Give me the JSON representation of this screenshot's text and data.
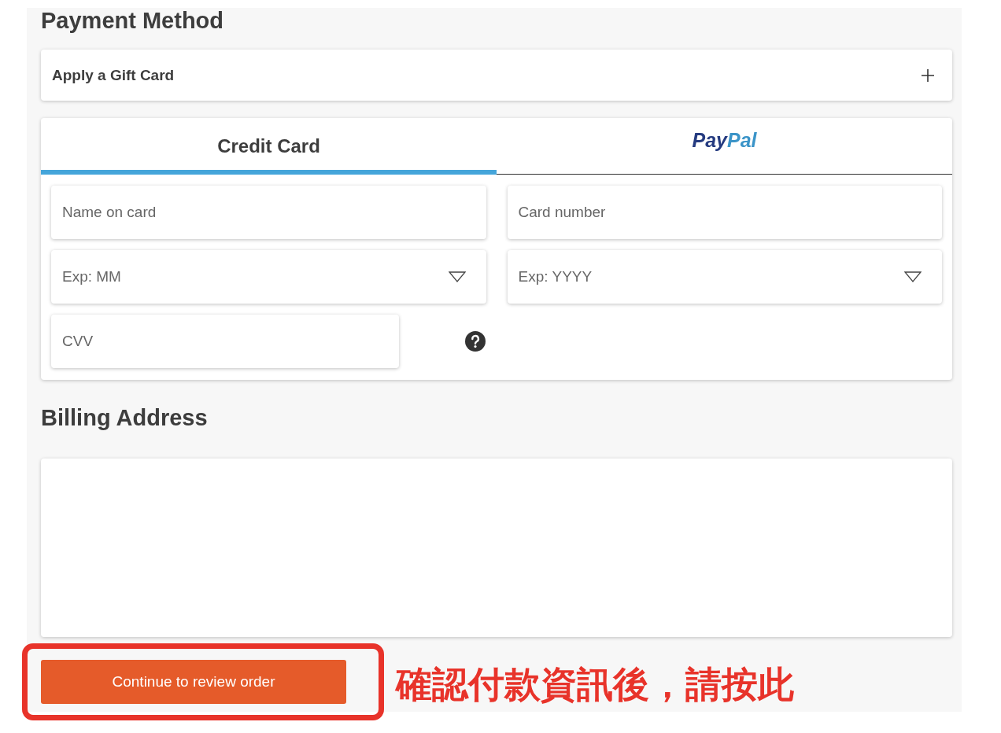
{
  "title": "Payment Method",
  "gift_card": {
    "label": "Apply a Gift Card",
    "expanded": false
  },
  "tabs": [
    {
      "kind": "text",
      "label": "Credit Card",
      "selected": true
    },
    {
      "kind": "logo",
      "parts": [
        "Pay",
        "Pal"
      ],
      "selected": false
    }
  ],
  "fields": [
    {
      "kind": "text",
      "placeholder": "Name on card"
    },
    {
      "kind": "text",
      "placeholder": "Card number"
    },
    {
      "kind": "select",
      "placeholder": "Exp: MM"
    },
    {
      "kind": "select",
      "placeholder": "Exp: YYYY"
    },
    {
      "kind": "help",
      "placeholder": "CVV"
    }
  ],
  "billing": {
    "title": "Billing Address"
  },
  "button": "Continue to review order",
  "annotation": "確認付款資訊後，請按此"
}
